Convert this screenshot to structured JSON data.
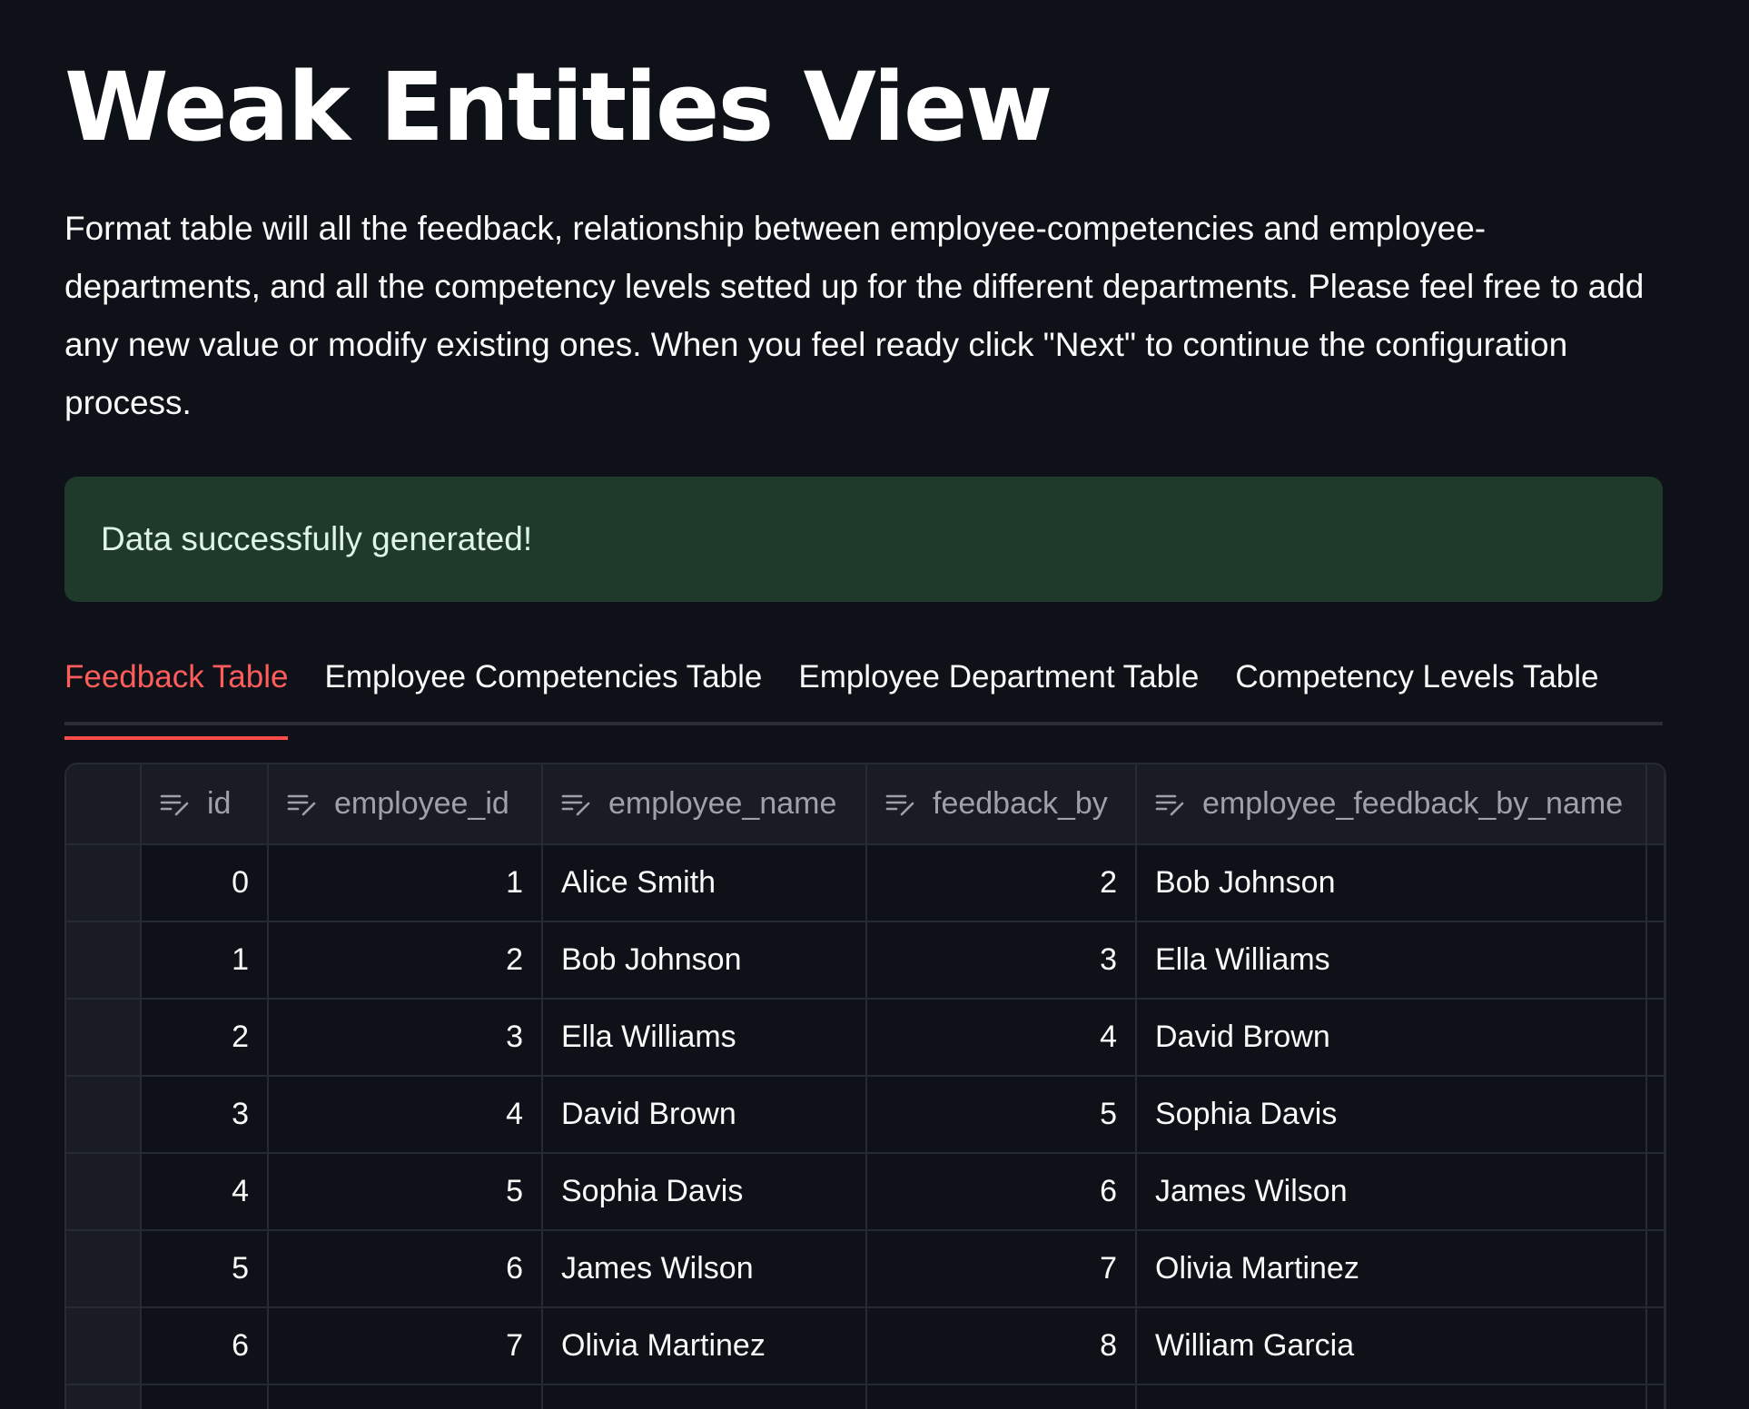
{
  "header": {
    "title": "Weak Entities View",
    "description": "Format table will all the feedback, relationship between employee-competencies and employee-departments, and all the competency levels setted up for the different departments. Please feel free to add any new value or modify existing ones. When you feel ready click \"Next\" to continue the configuration process."
  },
  "alert": {
    "message": "Data successfully generated!",
    "color": "#1f3a2b"
  },
  "tabs": [
    {
      "label": "Feedback Table",
      "active": true
    },
    {
      "label": "Employee Competencies Table",
      "active": false
    },
    {
      "label": "Employee Department Table",
      "active": false
    },
    {
      "label": "Competency Levels Table",
      "active": false
    }
  ],
  "accent_color": "#ff4b4b",
  "table": {
    "columns": [
      "id",
      "employee_id",
      "employee_name",
      "feedback_by",
      "employee_feedback_by_name"
    ],
    "column_icon": "text-edit-icon",
    "rows": [
      [
        "0",
        "1",
        "Alice Smith",
        "2",
        "Bob Johnson"
      ],
      [
        "1",
        "2",
        "Bob Johnson",
        "3",
        "Ella Williams"
      ],
      [
        "2",
        "3",
        "Ella Williams",
        "4",
        "David Brown"
      ],
      [
        "3",
        "4",
        "David Brown",
        "5",
        "Sophia Davis"
      ],
      [
        "4",
        "5",
        "Sophia Davis",
        "6",
        "James Wilson"
      ],
      [
        "5",
        "6",
        "James Wilson",
        "7",
        "Olivia Martinez"
      ],
      [
        "6",
        "7",
        "Olivia Martinez",
        "8",
        "William Garcia"
      ],
      [
        "",
        "",
        "",
        "",
        ""
      ]
    ]
  }
}
